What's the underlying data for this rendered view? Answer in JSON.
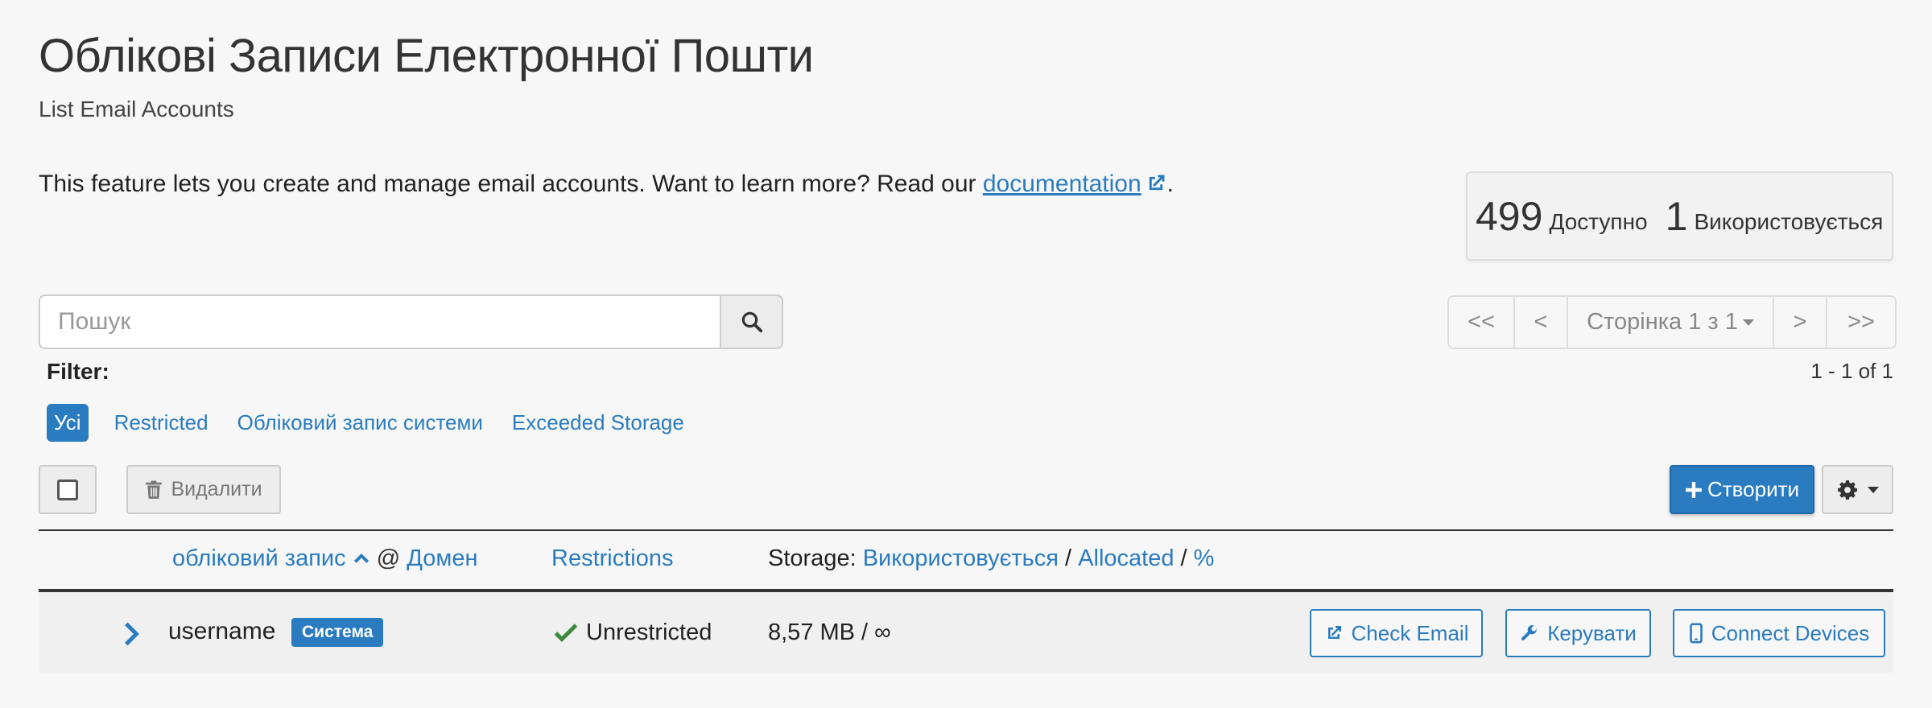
{
  "header": {
    "title": "Облікові Записи Електронної Пошти",
    "subtitle": "List Email Accounts",
    "intro_text": "This feature lets you create and manage email accounts. Want to learn more? Read our",
    "intro_link": "documentation",
    "intro_end": "."
  },
  "stats": {
    "available_count": "499",
    "available_label": "Доступно",
    "used_count": "1",
    "used_label": "Використовується"
  },
  "search": {
    "placeholder": "Пошук",
    "icon": "search-icon"
  },
  "pagination": {
    "first": "<<",
    "prev": "<",
    "page": "Сторінка 1 з 1",
    "next": ">",
    "last": ">>",
    "range": "1 - 1 of 1"
  },
  "filter": {
    "label": "Filter:",
    "options": [
      "Усі",
      "Restricted",
      "Обліковий запис системи",
      "Exceeded Storage"
    ],
    "active": "Усі"
  },
  "toolbar": {
    "delete_label": "Видалити",
    "create_label": "Створити",
    "settings_icon": "gear-icon"
  },
  "table": {
    "headers": {
      "account": "обліковий запис",
      "at": "@",
      "domain": "Домен",
      "restrictions": "Restrictions",
      "storage_prefix": "Storage:",
      "storage_used": "Використовується",
      "sep1": "/",
      "storage_allocated": "Allocated",
      "sep2": "/",
      "storage_percent": "%"
    },
    "rows": [
      {
        "username": "username",
        "badge": "Система",
        "restriction": "Unrestricted",
        "usage": "8,57 MB / ∞",
        "check_email": "Check Email",
        "manage": "Керувати",
        "connect": "Connect Devices"
      }
    ]
  },
  "colors": {
    "accent": "#2a7bc0",
    "success": "#3c8b3c",
    "background": "#f7f7f7"
  }
}
